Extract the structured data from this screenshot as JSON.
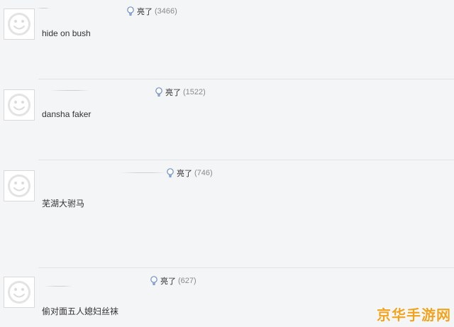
{
  "vote_label": "亮了",
  "comments": [
    {
      "avatar_icon": "smiley-icon",
      "vote_count": "(3466)",
      "text": "hide on bush"
    },
    {
      "avatar_icon": "smiley-icon",
      "vote_count": "(1522)",
      "text": "dansha faker"
    },
    {
      "avatar_icon": "smiley-icon",
      "vote_count": "(746)",
      "text": "芜湖大驸马"
    },
    {
      "avatar_icon": "smiley-icon",
      "vote_count": "(627)",
      "text": "偷对面五人媳妇丝袜"
    }
  ],
  "watermark": "京华手游网",
  "colors": {
    "background": "#f4f5f7",
    "watermark": "#f3a21f",
    "count_gray": "#8a8a8a"
  }
}
